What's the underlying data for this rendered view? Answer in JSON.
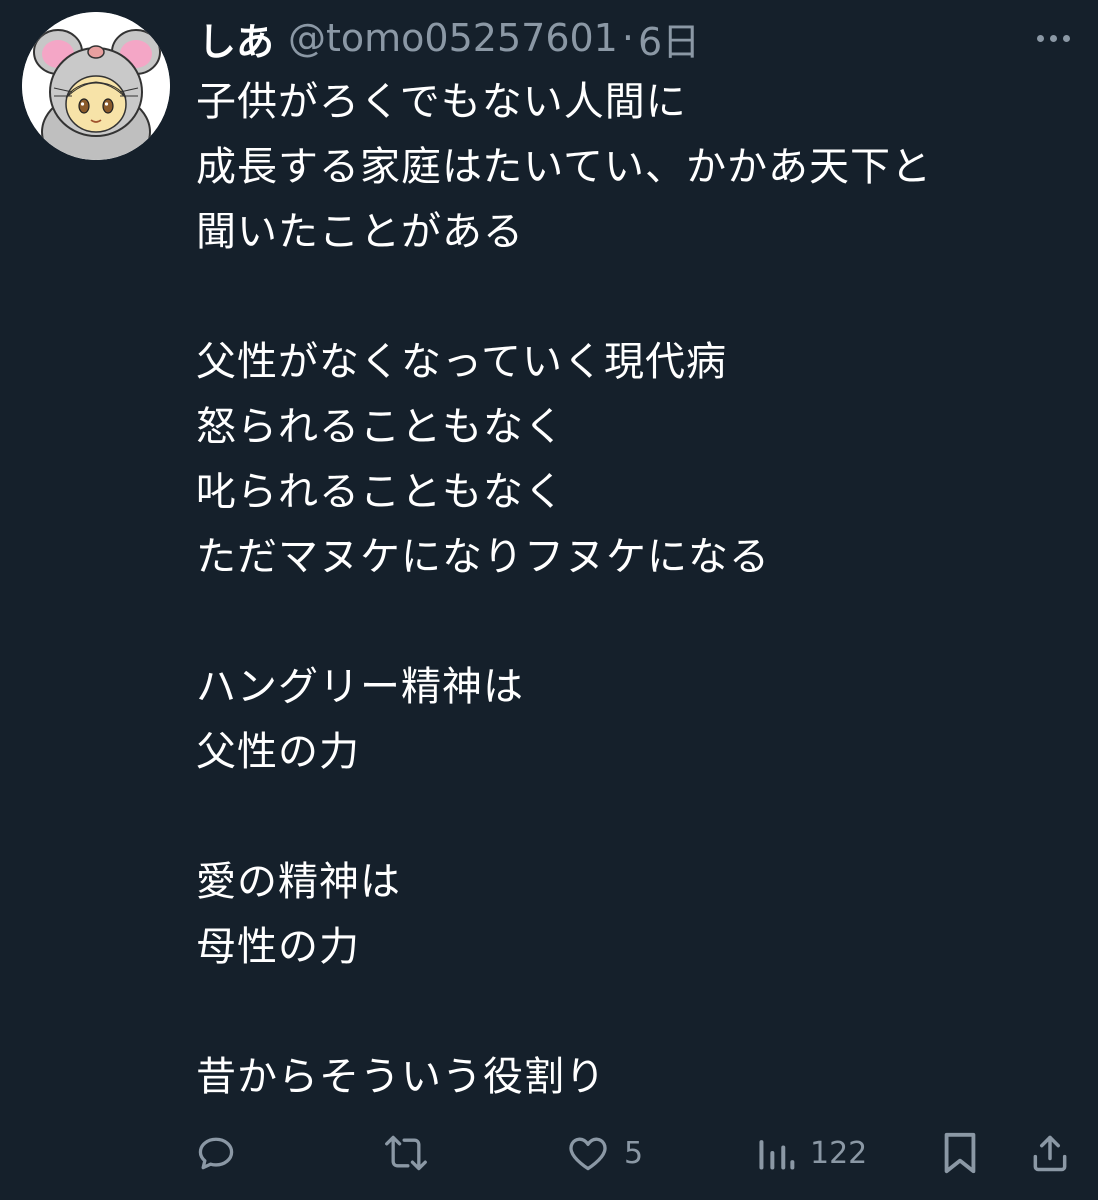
{
  "tweet": {
    "author": {
      "display_name": "しあ",
      "handle": "@tomo05257601",
      "avatar_icon": "chinchilla-avatar-icon"
    },
    "separator": "·",
    "time": "6日",
    "more_icon": "more-icon",
    "lines": [
      "子供がろくでもない人間に",
      "成長する家庭はたいてい、かかあ天下と",
      "聞いたことがある",
      "",
      "父性がなくなっていく現代病",
      "怒られることもなく",
      "叱られることもなく",
      "ただマヌケになりフヌケになる",
      "",
      "ハングリー精神は",
      "父性の力",
      "",
      "愛の精神は",
      "母性の力",
      "",
      "昔からそういう役割り"
    ]
  },
  "actions": {
    "reply": {
      "icon": "reply-icon"
    },
    "retweet": {
      "icon": "retweet-icon"
    },
    "like": {
      "icon": "heart-icon",
      "count": "5"
    },
    "views": {
      "icon": "views-icon",
      "count": "122"
    },
    "bookmark": {
      "icon": "bookmark-icon"
    },
    "share": {
      "icon": "share-icon"
    }
  },
  "colors": {
    "background": "#15202b",
    "text": "#ffffff",
    "secondary_text": "#8b98a5"
  }
}
